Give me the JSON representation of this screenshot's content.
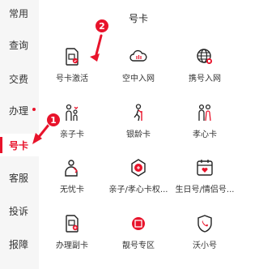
{
  "sidebar": {
    "items": [
      {
        "label": "常用"
      },
      {
        "label": "查询"
      },
      {
        "label": "交费"
      },
      {
        "label": "办理"
      },
      {
        "label": "号卡"
      },
      {
        "label": "客服"
      },
      {
        "label": "投诉"
      },
      {
        "label": "报障"
      }
    ],
    "active_index": 4
  },
  "section": {
    "title": "号卡",
    "items": [
      {
        "label": "号卡激活",
        "icon": "sim-activate-icon"
      },
      {
        "label": "空中入网",
        "icon": "cloud-sim-icon"
      },
      {
        "label": "携号入网",
        "icon": "globe-sim-icon"
      },
      {
        "label": "亲子卡",
        "icon": "parent-child-icon"
      },
      {
        "label": "银龄卡",
        "icon": "elderly-icon"
      },
      {
        "label": "孝心卡",
        "icon": "couple-icon"
      },
      {
        "label": "无忧卡",
        "icon": "worry-free-icon"
      },
      {
        "label": "亲子/孝心卡权...",
        "icon": "medal-icon"
      },
      {
        "label": "生日号/情侣号...",
        "icon": "calendar-heart-icon"
      },
      {
        "label": "办理副卡",
        "icon": "secondary-sim-icon"
      },
      {
        "label": "靓号专区",
        "icon": "lucky-number-icon"
      },
      {
        "label": "沃小号",
        "icon": "phone-shield-icon"
      }
    ]
  },
  "annotations": [
    {
      "number": "1",
      "color": "#e8132b"
    },
    {
      "number": "2",
      "color": "#e8132b"
    }
  ],
  "colors": {
    "accent": "#e8132b",
    "sidebar_bg": "#f6f6f6"
  }
}
